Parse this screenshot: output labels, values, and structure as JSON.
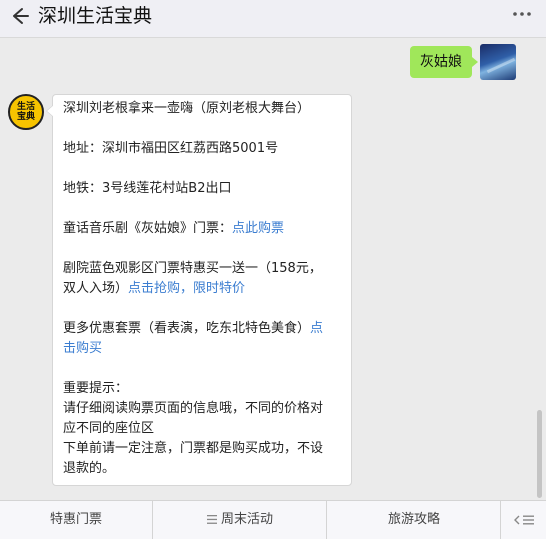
{
  "header": {
    "title": "深圳生活宝典"
  },
  "user_message": {
    "text": "灰姑娘"
  },
  "bot_avatar": {
    "line1": "生活",
    "line2": "宝典"
  },
  "bot_message": {
    "line_venue": "深圳刘老根拿来一壶嗨（原刘老根大舞台）",
    "line_address": "地址：深圳市福田区红荔西路5001号",
    "line_metro": "地铁：3号线莲花村站B2出口",
    "ticket_prefix": "童话音乐剧《灰姑娘》门票：",
    "ticket_link": "点此购票",
    "promo_line1": "剧院蓝色观影区门票特惠买一送一（158元，",
    "promo_line2_prefix": "双人入场）",
    "promo_link": "点击抢购，限时特价",
    "more_prefix": "更多优惠套票（看表演，吃东北特色美食）",
    "more_link_part1": "点",
    "more_link_part2": "击购买",
    "notice_title": "重要提示：",
    "notice_line1": "请仔细阅读购票页面的信息哦，不同的价格对",
    "notice_line2": "应不同的座位区",
    "notice_line3": "下单前请一定注意，门票都是购买成功，不设",
    "notice_line4": "退款的。"
  },
  "bottom_menu": {
    "tab1": "特惠门票",
    "tab2": "周末活动",
    "tab3": "旅游攻略"
  },
  "icons": {
    "back": "back-arrow-icon",
    "more": "more-dots-icon",
    "menu": "menu-lines-icon",
    "keyboard_toggle": "keyboard-toggle-icon"
  },
  "colors": {
    "bubble_me": "#a0e75a",
    "link": "#3b7dd0",
    "bot_avatar": "#f7c400"
  }
}
